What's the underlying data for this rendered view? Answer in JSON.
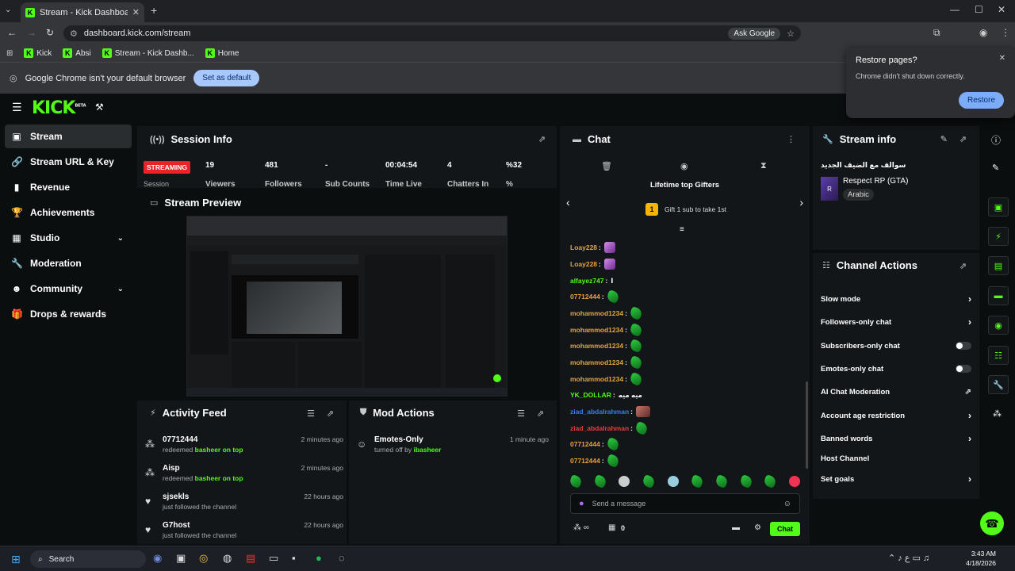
{
  "browser": {
    "tab_title": "Stream - Kick Dashboard",
    "url": "dashboard.kick.com/stream",
    "ask_google": "Ask Google",
    "bookmarks": [
      "Kick",
      "Absi",
      "Stream - Kick Dashb...",
      "Home"
    ],
    "default_msg": "Google Chrome isn't your default browser",
    "set_default": "Set as default",
    "restore_title": "Restore pages?",
    "restore_msg": "Chrome didn't shut down correctly.",
    "restore_btn": "Restore"
  },
  "app": {
    "logo": "KICK",
    "logo_sup": "BETA"
  },
  "sidebar": {
    "items": [
      {
        "label": "Stream",
        "icon": "stream-icon"
      },
      {
        "label": "Stream URL & Key",
        "icon": "link-icon"
      },
      {
        "label": "Revenue",
        "icon": "revenue-icon"
      },
      {
        "label": "Achievements",
        "icon": "trophy-icon"
      },
      {
        "label": "Studio",
        "icon": "studio-icon"
      },
      {
        "label": "Moderation",
        "icon": "wrench-icon"
      },
      {
        "label": "Community",
        "icon": "people-icon"
      },
      {
        "label": "Drops & rewards",
        "icon": "gift-icon"
      }
    ]
  },
  "session": {
    "title": "Session Info",
    "status": "STREAMING",
    "status_sub": "Session",
    "stats": [
      {
        "value": "19",
        "label": "Viewers"
      },
      {
        "value": "481",
        "label": "Followers"
      },
      {
        "value": "-",
        "label": "Sub Counts"
      },
      {
        "value": "00:04:54",
        "label": "Time Live"
      },
      {
        "value": "4",
        "label": "Chatters In"
      },
      {
        "value": "%32",
        "label": "%"
      }
    ]
  },
  "preview": {
    "title": "Stream Preview"
  },
  "activity": {
    "title": "Activity Feed",
    "items": [
      {
        "name": "07712444",
        "pre": "redeemed ",
        "highlight": "basheer on top",
        "time": "2 minutes ago"
      },
      {
        "name": "Aisp",
        "pre": "redeemed ",
        "highlight": "basheer on top",
        "time": "2 minutes ago"
      },
      {
        "name": "sjsekls",
        "pre": "just followed the channel",
        "highlight": "",
        "time": "22 hours ago"
      },
      {
        "name": "G7host",
        "pre": "just followed the channel",
        "highlight": "",
        "time": "22 hours ago"
      }
    ]
  },
  "mod": {
    "title": "Mod Actions",
    "items": [
      {
        "name": "Emotes-Only",
        "pre": "turned off by ",
        "highlight": "ibasheer",
        "time": "1 minute ago"
      }
    ]
  },
  "chat": {
    "title": "Chat",
    "gifters_title": "Lifetime top Gifters",
    "gifters_rank": "1",
    "gifters_msg": "Gift 1 sub to take 1st",
    "messages": [
      {
        "user": "Loay228",
        "color": "#e8a33d",
        "text": "",
        "emotes": 1,
        "emote": "purple"
      },
      {
        "user": "Loay228",
        "color": "#e8a33d",
        "text": "",
        "emotes": 1,
        "emote": "purple"
      },
      {
        "user": "alfayez747",
        "color": "#53fc18",
        "text": "ا",
        "emotes": 0,
        "emote": ""
      },
      {
        "user": "07712444",
        "color": "#e8a33d",
        "text": "",
        "emotes": 1,
        "emote": "green"
      },
      {
        "user": "mohammod1234",
        "color": "#e8a33d",
        "text": "",
        "emotes": 1,
        "emote": "green"
      },
      {
        "user": "mohammod1234",
        "color": "#e8a33d",
        "text": "",
        "emotes": 1,
        "emote": "green"
      },
      {
        "user": "mohammod1234",
        "color": "#e8a33d",
        "text": "",
        "emotes": 1,
        "emote": "green"
      },
      {
        "user": "mohammod1234",
        "color": "#e8a33d",
        "text": "",
        "emotes": 1,
        "emote": "green"
      },
      {
        "user": "mohammod1234",
        "color": "#e8a33d",
        "text": "",
        "emotes": 1,
        "emote": "green"
      },
      {
        "user": "YK_DOLLAR",
        "color": "#53fc18",
        "text": "ميه ميه",
        "emotes": 0,
        "emote": ""
      },
      {
        "user": "ziad_abdalrahman",
        "color": "#3d7be8",
        "text": "",
        "emotes": 1,
        "emote": "img"
      },
      {
        "user": "ziad_abdalrahman",
        "color": "#e83d3d",
        "text": "",
        "emotes": 1,
        "emote": "green"
      },
      {
        "user": "07712444",
        "color": "#e8a33d",
        "text": "",
        "emotes": 1,
        "emote": "green"
      },
      {
        "user": "07712444",
        "color": "#e8a33d",
        "text": "",
        "emotes": 1,
        "emote": "green"
      }
    ],
    "placeholder": "Send a message",
    "points": "0",
    "send_btn": "Chat"
  },
  "stream_info": {
    "title": "Stream info",
    "stream_title": "سوالف مع الضيف الجديد",
    "category": "Respect RP (GTA)",
    "language": "Arabic"
  },
  "channel_actions": {
    "title": "Channel Actions",
    "items": [
      {
        "label": "Slow mode",
        "control": "chevron"
      },
      {
        "label": "Followers-only chat",
        "control": "chevron"
      },
      {
        "label": "Subscribers-only chat",
        "control": "toggle"
      },
      {
        "label": "Emotes-only chat",
        "control": "toggle"
      },
      {
        "label": "AI Chat Moderation",
        "control": "external"
      },
      {
        "label": "Account age restriction",
        "control": "chevron"
      },
      {
        "label": "Banned words",
        "control": "chevron"
      },
      {
        "label": "Host Channel",
        "control": "none"
      },
      {
        "label": "Set goals",
        "control": "chevron"
      }
    ]
  },
  "taskbar": {
    "search": "Search",
    "time": "3:43 AM",
    "date": "4/18/2026"
  },
  "colors": {
    "accent": "#53fc18",
    "panel": "#131619",
    "bg": "#0b0e0f",
    "streaming": "#e8232c"
  }
}
